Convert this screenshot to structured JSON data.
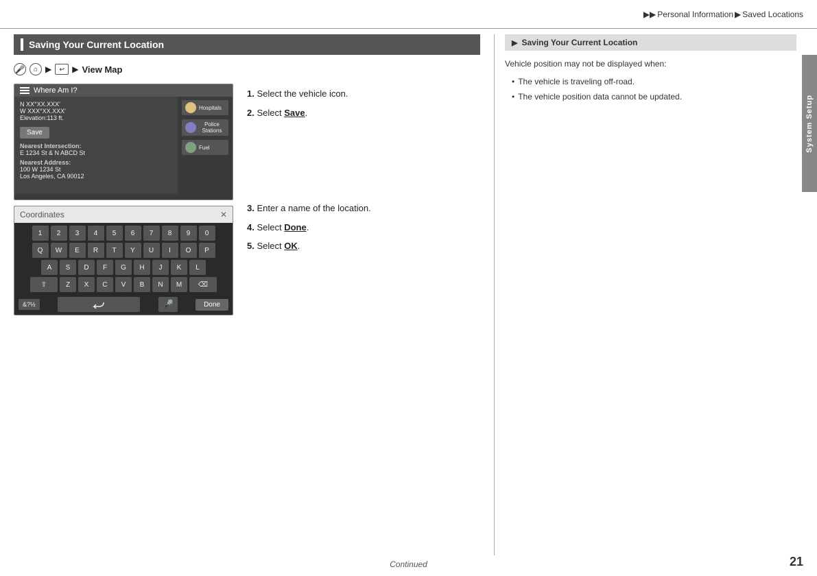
{
  "header": {
    "breadcrumb": [
      "Personal Information",
      "Saved Locations"
    ],
    "arrow": "▶▶"
  },
  "section": {
    "title": "Saving Your Current Location",
    "nav": {
      "mic_icon": "🎤",
      "home_icon": "⌂",
      "arrows": [
        "▶",
        "▶"
      ],
      "map_icon": "↩",
      "label": "View Map"
    },
    "map_screen": {
      "title": "Where Am I?",
      "location_label": "N XX°XX.XXX'",
      "location_label2": "W XXX°XX.XXX'",
      "elevation": "Elevation:113 ft.",
      "intersection_label": "Nearest Intersection:",
      "intersection_value": "E 1234 St & N ABCD St",
      "address_label": "Nearest Address:",
      "address_line1": "100 W 1234 St",
      "address_line2": "Los Angeles, CA 90012",
      "save_btn": "Save",
      "poi1": "Hospitals",
      "poi2": "Police Stations",
      "poi3": "Fuel"
    },
    "keyboard_screen": {
      "search_placeholder": "Coordinates",
      "rows": {
        "row1": [
          "1",
          "2",
          "3",
          "4",
          "5",
          "6",
          "7",
          "8",
          "9",
          "0"
        ],
        "row2": [
          "Q",
          "W",
          "E",
          "R",
          "T",
          "Y",
          "U",
          "I",
          "O",
          "P"
        ],
        "row3": [
          "A",
          "S",
          "D",
          "F",
          "G",
          "H",
          "J",
          "K",
          "L"
        ],
        "row4": [
          "⇧",
          "Z",
          "X",
          "C",
          "V",
          "B",
          "N",
          "M",
          "⌫"
        ]
      },
      "sym_btn": "&?½",
      "mic_btn": "🎤",
      "done_btn": "Done"
    },
    "steps": [
      {
        "num": "1.",
        "text": "Select the vehicle icon."
      },
      {
        "num": "2.",
        "text": "Select ",
        "bold": "Save",
        "rest": "."
      },
      {
        "num": "3.",
        "text": "Enter a name of the location."
      },
      {
        "num": "4.",
        "text": "Select ",
        "bold": "Done",
        "rest": "."
      },
      {
        "num": "5.",
        "text": "Select ",
        "bold": "OK",
        "rest": "."
      }
    ]
  },
  "right_panel": {
    "header": "Saving Your Current Location",
    "intro": "Vehicle position may not be displayed when:",
    "bullets": [
      "The vehicle is traveling off-road.",
      "The vehicle position data cannot be updated."
    ]
  },
  "footer": {
    "continued": "Continued",
    "page": "21"
  },
  "right_tab": {
    "label": "System Setup"
  }
}
